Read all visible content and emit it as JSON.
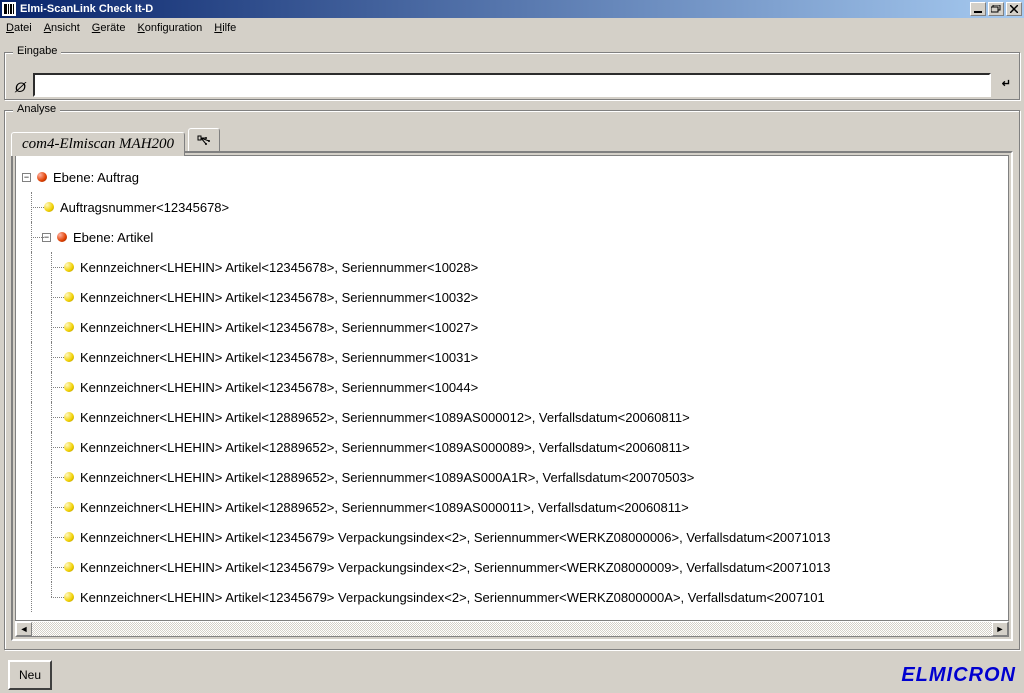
{
  "title": "Elmi-ScanLink Check It-D",
  "menu": {
    "datei": "Datei",
    "ansicht": "Ansicht",
    "geraete": "Geräte",
    "konfig": "Konfiguration",
    "hilfe": "Hilfe"
  },
  "eingabe": {
    "legend": "Eingabe",
    "value": ""
  },
  "analyse": {
    "legend": "Analyse",
    "tab_label": "com4-Elmiscan MAH200",
    "tree": [
      {
        "level": 0,
        "expander": "-",
        "bullet": "red",
        "text": "Ebene: Auftrag"
      },
      {
        "level": 1,
        "bullet": "yellow",
        "text": "Auftragsnummer<12345678>"
      },
      {
        "level": 1,
        "expander": "-",
        "bullet": "red",
        "text": "Ebene: Artikel"
      },
      {
        "level": 2,
        "bullet": "yellow",
        "text": "Kennzeichner<LHEHIN> Artikel<12345678>, Seriennummer<10028>"
      },
      {
        "level": 2,
        "bullet": "yellow",
        "text": "Kennzeichner<LHEHIN> Artikel<12345678>, Seriennummer<10032>"
      },
      {
        "level": 2,
        "bullet": "yellow",
        "text": "Kennzeichner<LHEHIN> Artikel<12345678>, Seriennummer<10027>"
      },
      {
        "level": 2,
        "bullet": "yellow",
        "text": "Kennzeichner<LHEHIN> Artikel<12345678>, Seriennummer<10031>"
      },
      {
        "level": 2,
        "bullet": "yellow",
        "text": "Kennzeichner<LHEHIN> Artikel<12345678>, Seriennummer<10044>"
      },
      {
        "level": 2,
        "bullet": "yellow",
        "text": "Kennzeichner<LHEHIN> Artikel<12889652>, Seriennummer<1089AS000012>, Verfallsdatum<20060811>"
      },
      {
        "level": 2,
        "bullet": "yellow",
        "text": "Kennzeichner<LHEHIN> Artikel<12889652>, Seriennummer<1089AS000089>, Verfallsdatum<20060811>"
      },
      {
        "level": 2,
        "bullet": "yellow",
        "text": "Kennzeichner<LHEHIN> Artikel<12889652>, Seriennummer<1089AS000A1R>, Verfallsdatum<20070503>"
      },
      {
        "level": 2,
        "bullet": "yellow",
        "text": "Kennzeichner<LHEHIN> Artikel<12889652>, Seriennummer<1089AS000011>, Verfallsdatum<20060811>"
      },
      {
        "level": 2,
        "bullet": "yellow",
        "text": "Kennzeichner<LHEHIN> Artikel<12345679> Verpackungsindex<2>, Seriennummer<WERKZ08000006>, Verfallsdatum<20071013"
      },
      {
        "level": 2,
        "bullet": "yellow",
        "text": "Kennzeichner<LHEHIN> Artikel<12345679> Verpackungsindex<2>, Seriennummer<WERKZ08000009>, Verfallsdatum<20071013"
      },
      {
        "level": 2,
        "bullet": "yellow",
        "last": true,
        "text": "Kennzeichner<LHEHIN> Artikel<12345679> Verpackungsindex<2>, Seriennummer<WERKZ0800000A>, Verfallsdatum<2007101"
      }
    ]
  },
  "bottom": {
    "neu": "Neu",
    "brand": "ELMICRON"
  }
}
